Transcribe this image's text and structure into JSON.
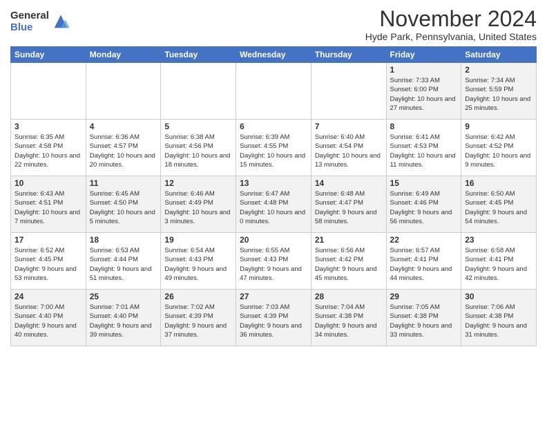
{
  "logo": {
    "general": "General",
    "blue": "Blue"
  },
  "title": "November 2024",
  "location": "Hyde Park, Pennsylvania, United States",
  "days_header": [
    "Sunday",
    "Monday",
    "Tuesday",
    "Wednesday",
    "Thursday",
    "Friday",
    "Saturday"
  ],
  "weeks": [
    [
      {
        "day": "",
        "info": ""
      },
      {
        "day": "",
        "info": ""
      },
      {
        "day": "",
        "info": ""
      },
      {
        "day": "",
        "info": ""
      },
      {
        "day": "",
        "info": ""
      },
      {
        "day": "1",
        "info": "Sunrise: 7:33 AM\nSunset: 6:00 PM\nDaylight: 10 hours and 27 minutes."
      },
      {
        "day": "2",
        "info": "Sunrise: 7:34 AM\nSunset: 5:59 PM\nDaylight: 10 hours and 25 minutes."
      }
    ],
    [
      {
        "day": "3",
        "info": "Sunrise: 6:35 AM\nSunset: 4:58 PM\nDaylight: 10 hours and 22 minutes."
      },
      {
        "day": "4",
        "info": "Sunrise: 6:36 AM\nSunset: 4:57 PM\nDaylight: 10 hours and 20 minutes."
      },
      {
        "day": "5",
        "info": "Sunrise: 6:38 AM\nSunset: 4:56 PM\nDaylight: 10 hours and 18 minutes."
      },
      {
        "day": "6",
        "info": "Sunrise: 6:39 AM\nSunset: 4:55 PM\nDaylight: 10 hours and 15 minutes."
      },
      {
        "day": "7",
        "info": "Sunrise: 6:40 AM\nSunset: 4:54 PM\nDaylight: 10 hours and 13 minutes."
      },
      {
        "day": "8",
        "info": "Sunrise: 6:41 AM\nSunset: 4:53 PM\nDaylight: 10 hours and 11 minutes."
      },
      {
        "day": "9",
        "info": "Sunrise: 6:42 AM\nSunset: 4:52 PM\nDaylight: 10 hours and 9 minutes."
      }
    ],
    [
      {
        "day": "10",
        "info": "Sunrise: 6:43 AM\nSunset: 4:51 PM\nDaylight: 10 hours and 7 minutes."
      },
      {
        "day": "11",
        "info": "Sunrise: 6:45 AM\nSunset: 4:50 PM\nDaylight: 10 hours and 5 minutes."
      },
      {
        "day": "12",
        "info": "Sunrise: 6:46 AM\nSunset: 4:49 PM\nDaylight: 10 hours and 3 minutes."
      },
      {
        "day": "13",
        "info": "Sunrise: 6:47 AM\nSunset: 4:48 PM\nDaylight: 10 hours and 0 minutes."
      },
      {
        "day": "14",
        "info": "Sunrise: 6:48 AM\nSunset: 4:47 PM\nDaylight: 9 hours and 58 minutes."
      },
      {
        "day": "15",
        "info": "Sunrise: 6:49 AM\nSunset: 4:46 PM\nDaylight: 9 hours and 56 minutes."
      },
      {
        "day": "16",
        "info": "Sunrise: 6:50 AM\nSunset: 4:45 PM\nDaylight: 9 hours and 54 minutes."
      }
    ],
    [
      {
        "day": "17",
        "info": "Sunrise: 6:52 AM\nSunset: 4:45 PM\nDaylight: 9 hours and 53 minutes."
      },
      {
        "day": "18",
        "info": "Sunrise: 6:53 AM\nSunset: 4:44 PM\nDaylight: 9 hours and 51 minutes."
      },
      {
        "day": "19",
        "info": "Sunrise: 6:54 AM\nSunset: 4:43 PM\nDaylight: 9 hours and 49 minutes."
      },
      {
        "day": "20",
        "info": "Sunrise: 6:55 AM\nSunset: 4:43 PM\nDaylight: 9 hours and 47 minutes."
      },
      {
        "day": "21",
        "info": "Sunrise: 6:56 AM\nSunset: 4:42 PM\nDaylight: 9 hours and 45 minutes."
      },
      {
        "day": "22",
        "info": "Sunrise: 6:57 AM\nSunset: 4:41 PM\nDaylight: 9 hours and 44 minutes."
      },
      {
        "day": "23",
        "info": "Sunrise: 6:58 AM\nSunset: 4:41 PM\nDaylight: 9 hours and 42 minutes."
      }
    ],
    [
      {
        "day": "24",
        "info": "Sunrise: 7:00 AM\nSunset: 4:40 PM\nDaylight: 9 hours and 40 minutes."
      },
      {
        "day": "25",
        "info": "Sunrise: 7:01 AM\nSunset: 4:40 PM\nDaylight: 9 hours and 39 minutes."
      },
      {
        "day": "26",
        "info": "Sunrise: 7:02 AM\nSunset: 4:39 PM\nDaylight: 9 hours and 37 minutes."
      },
      {
        "day": "27",
        "info": "Sunrise: 7:03 AM\nSunset: 4:39 PM\nDaylight: 9 hours and 36 minutes."
      },
      {
        "day": "28",
        "info": "Sunrise: 7:04 AM\nSunset: 4:38 PM\nDaylight: 9 hours and 34 minutes."
      },
      {
        "day": "29",
        "info": "Sunrise: 7:05 AM\nSunset: 4:38 PM\nDaylight: 9 hours and 33 minutes."
      },
      {
        "day": "30",
        "info": "Sunrise: 7:06 AM\nSunset: 4:38 PM\nDaylight: 9 hours and 31 minutes."
      }
    ]
  ]
}
